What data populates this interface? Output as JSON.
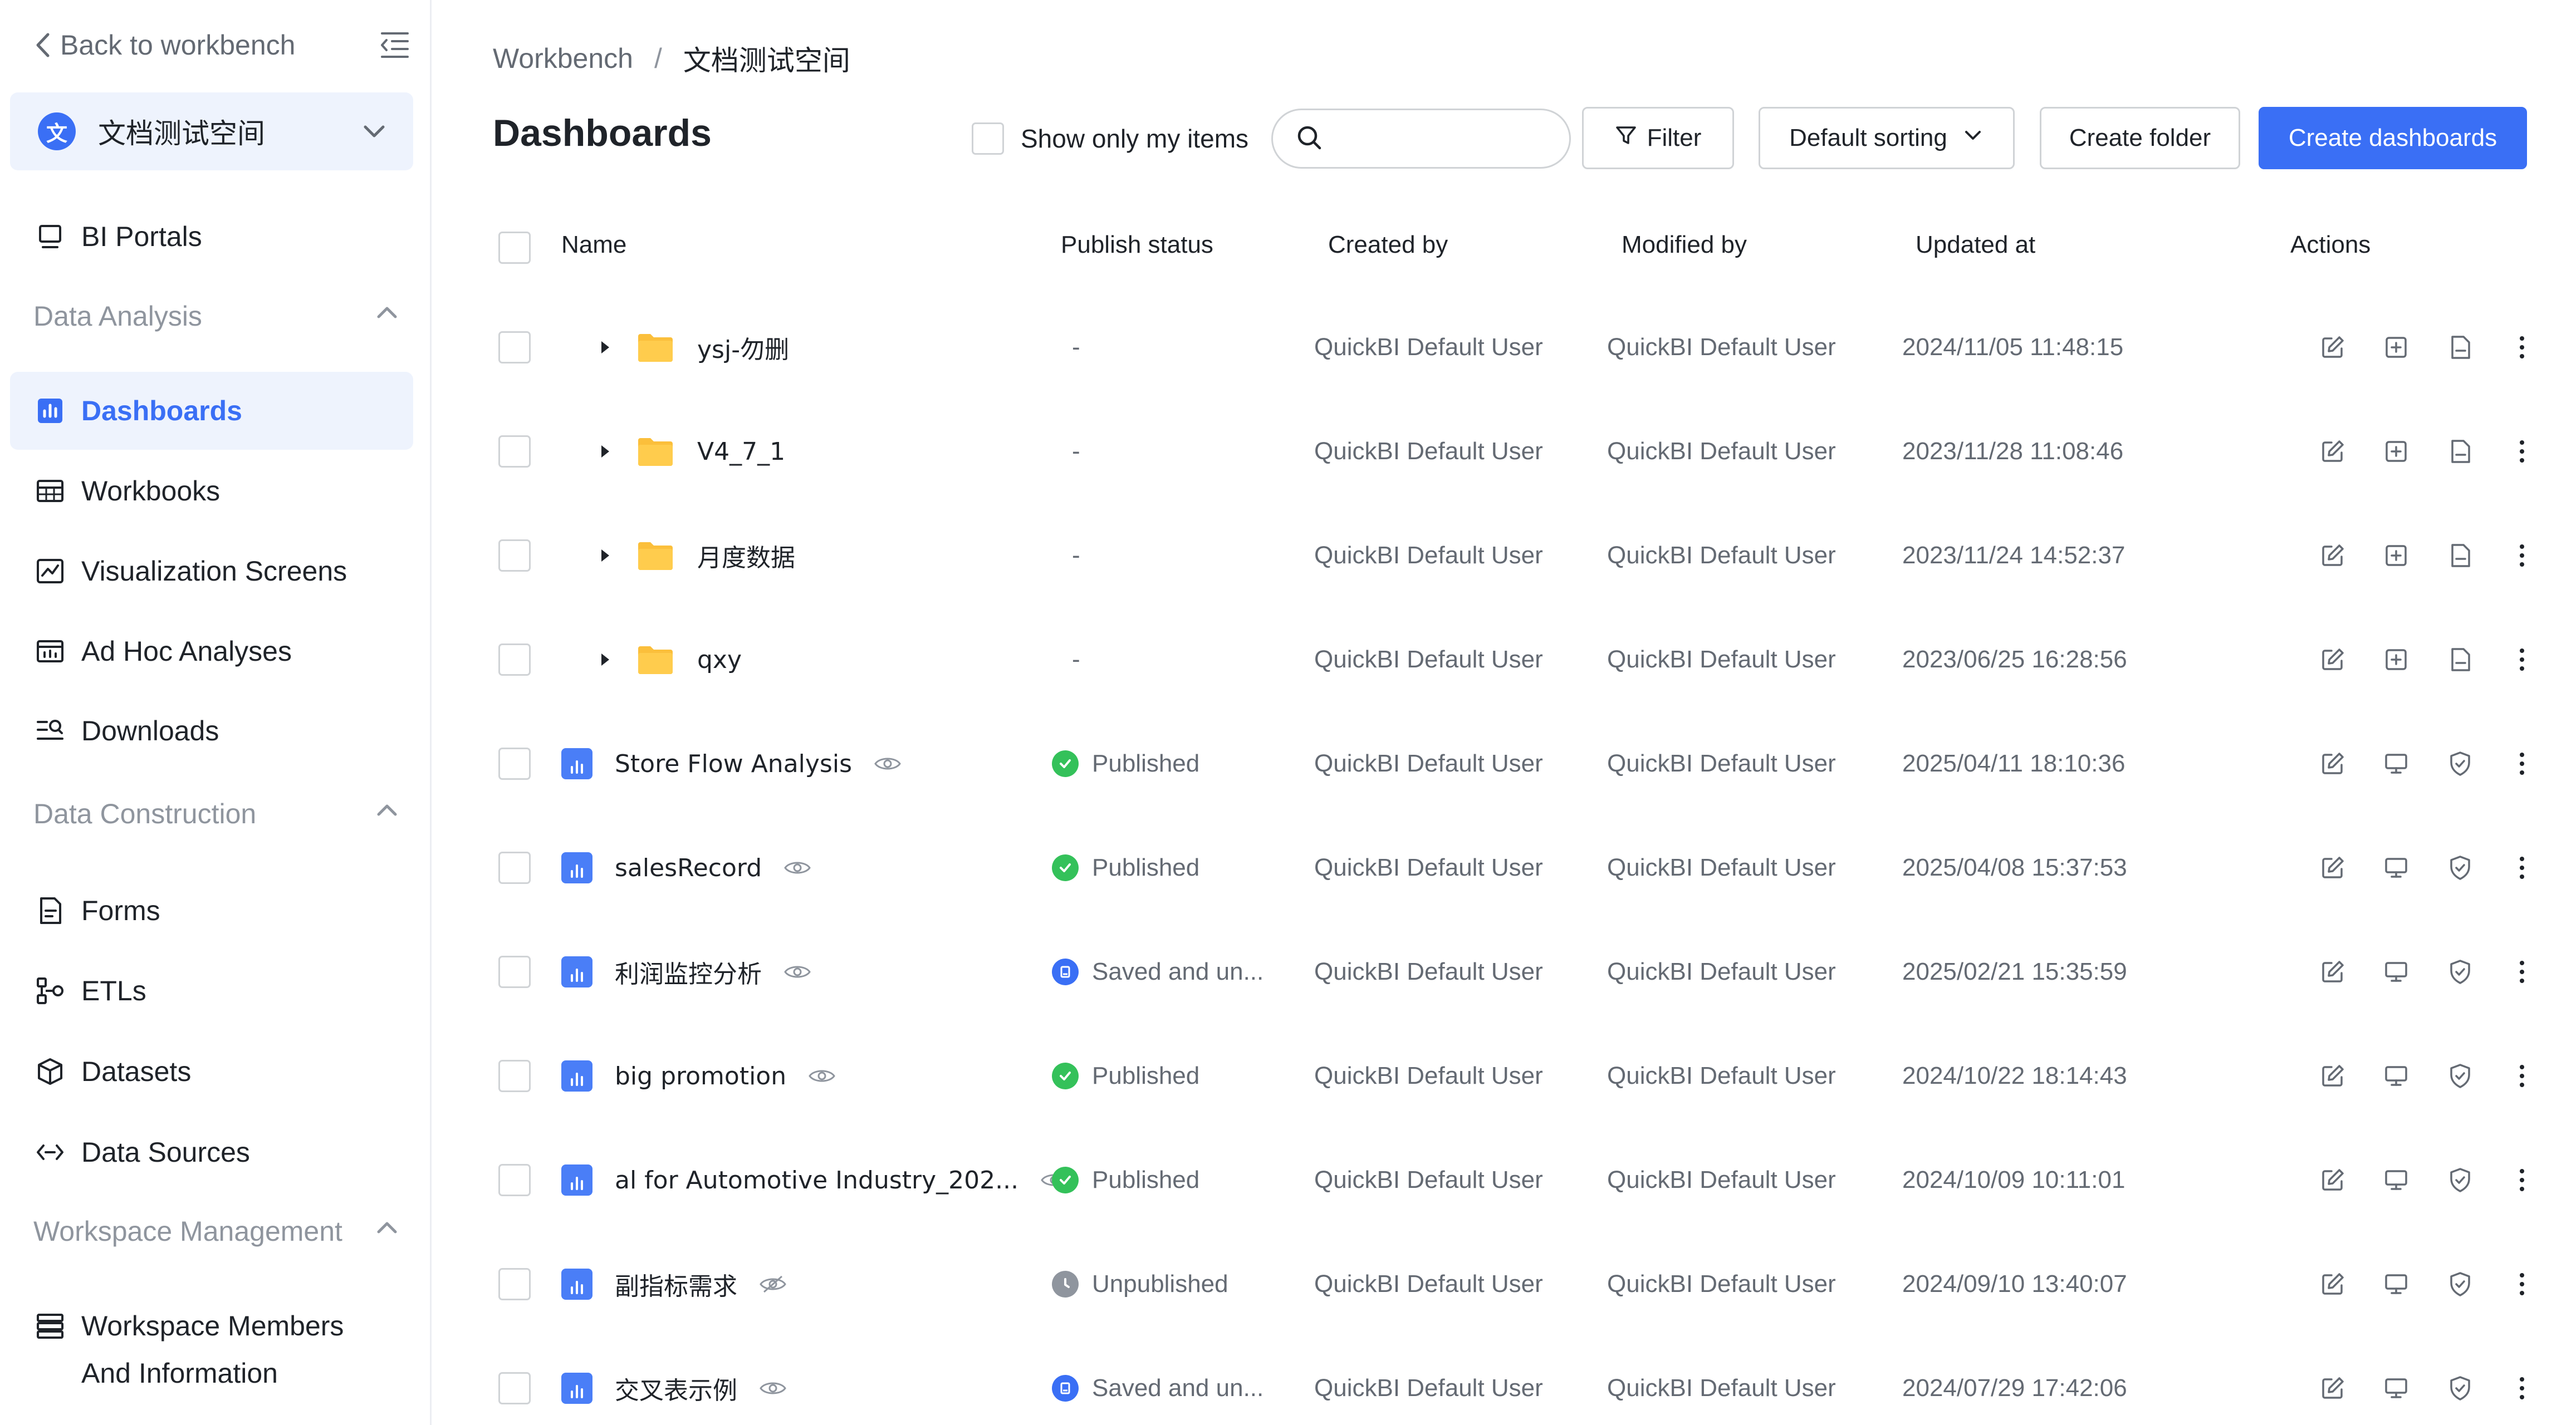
{
  "sidebar": {
    "back_label": "Back to workbench",
    "workspace": {
      "badge": "文",
      "name": "文档测试空间"
    },
    "bi_portals": "BI Portals",
    "group_data_analysis": "Data Analysis",
    "dashboards": "Dashboards",
    "workbooks": "Workbooks",
    "visualization_screens": "Visualization Screens",
    "ad_hoc_analyses": "Ad Hoc Analyses",
    "downloads": "Downloads",
    "group_data_construction": "Data Construction",
    "forms": "Forms",
    "etls": "ETLs",
    "datasets": "Datasets",
    "data_sources": "Data Sources",
    "group_workspace_management": "Workspace Management",
    "workspace_members_line1": "Workspace Members",
    "workspace_members_line2": "And Information"
  },
  "breadcrumb": {
    "root": "Workbench",
    "separator": "/",
    "current": "文档测试空间"
  },
  "page_title": "Dashboards",
  "toolbar": {
    "show_only_my_items": "Show only my items",
    "search_placeholder": "",
    "filter_label": "Filter",
    "sort_label": "Default sorting",
    "create_folder_label": "Create folder",
    "create_dashboards_label": "Create dashboards"
  },
  "table": {
    "columns": {
      "name": "Name",
      "publish_status": "Publish status",
      "created_by": "Created by",
      "modified_by": "Modified by",
      "updated_at": "Updated at",
      "actions": "Actions"
    },
    "rows": [
      {
        "type": "folder",
        "name": "ysj-勿删",
        "status": "-",
        "created_by": "QuickBI Default User",
        "modified_by": "QuickBI Default User",
        "updated_at": "2024/11/05 11:48:15"
      },
      {
        "type": "folder",
        "name": "V4_7_1",
        "status": "-",
        "created_by": "QuickBI Default User",
        "modified_by": "QuickBI Default User",
        "updated_at": "2023/11/28 11:08:46"
      },
      {
        "type": "folder",
        "name": "月度数据",
        "status": "-",
        "created_by": "QuickBI Default User",
        "modified_by": "QuickBI Default User",
        "updated_at": "2023/11/24 14:52:37"
      },
      {
        "type": "folder",
        "name": "qxy",
        "status": "-",
        "created_by": "QuickBI Default User",
        "modified_by": "QuickBI Default User",
        "updated_at": "2023/06/25 16:28:56"
      },
      {
        "type": "dashboard",
        "name": "Store Flow Analysis",
        "status": "Published",
        "created_by": "QuickBI Default User",
        "modified_by": "QuickBI Default User",
        "updated_at": "2025/04/11 18:10:36"
      },
      {
        "type": "dashboard",
        "name": "salesRecord",
        "status": "Published",
        "created_by": "QuickBI Default User",
        "modified_by": "QuickBI Default User",
        "updated_at": "2025/04/08 15:37:53"
      },
      {
        "type": "dashboard",
        "name": "利润监控分析",
        "status": "Saved and un...",
        "created_by": "QuickBI Default User",
        "modified_by": "QuickBI Default User",
        "updated_at": "2025/02/21 15:35:59"
      },
      {
        "type": "dashboard",
        "name": "big promotion",
        "status": "Published",
        "created_by": "QuickBI Default User",
        "modified_by": "QuickBI Default User",
        "updated_at": "2024/10/22 18:14:43"
      },
      {
        "type": "dashboard",
        "name": "al for Automotive Industry_202...",
        "status": "Published",
        "created_by": "QuickBI Default User",
        "modified_by": "QuickBI Default User",
        "updated_at": "2024/10/09 10:11:01"
      },
      {
        "type": "dashboard",
        "name": "副指标需求",
        "status": "Unpublished",
        "created_by": "QuickBI Default User",
        "modified_by": "QuickBI Default User",
        "updated_at": "2024/09/10 13:40:07"
      },
      {
        "type": "dashboard",
        "name": "交叉表示例",
        "status": "Saved and un...",
        "created_by": "QuickBI Default User",
        "modified_by": "QuickBI Default User",
        "updated_at": "2024/07/29 17:42:06"
      }
    ]
  },
  "colors": {
    "accent": "#3a6ff5",
    "active_bg": "#eef3fd",
    "published": "#34c15a",
    "saved_unpublished": "#3a6ff5",
    "unpublished": "#8f959e",
    "folder": "#fbbf3b"
  }
}
